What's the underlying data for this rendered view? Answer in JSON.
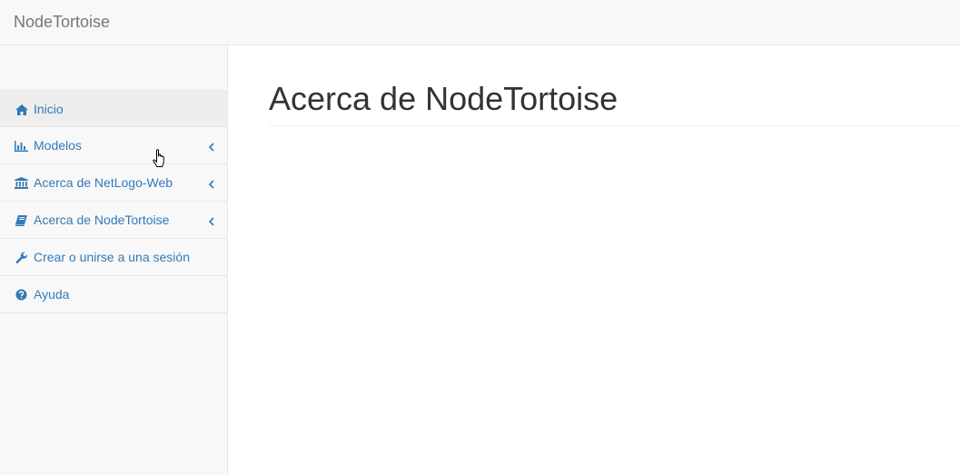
{
  "navbar": {
    "brand": "NodeTortoise"
  },
  "sidebar": {
    "items": [
      {
        "label": "Inicio",
        "icon": "home-icon",
        "has_submenu": false,
        "active": true
      },
      {
        "label": "Modelos",
        "icon": "bar-chart-icon",
        "has_submenu": true,
        "active": false
      },
      {
        "label": "Acerca de NetLogo-Web",
        "icon": "bank-icon",
        "has_submenu": true,
        "active": false
      },
      {
        "label": "Acerca de NodeTortoise",
        "icon": "book-icon",
        "has_submenu": true,
        "active": false
      },
      {
        "label": "Crear o unirse a una sesión",
        "icon": "wrench-icon",
        "has_submenu": false,
        "active": false
      },
      {
        "label": "Ayuda",
        "icon": "question-circle-icon",
        "has_submenu": false,
        "active": false
      }
    ]
  },
  "main": {
    "title": "Acerca de NodeTortoise"
  },
  "colors": {
    "link": "#337ab7",
    "navbar_bg": "#f8f8f8",
    "border": "#e7e7e7",
    "active_bg": "#eeeeee"
  }
}
